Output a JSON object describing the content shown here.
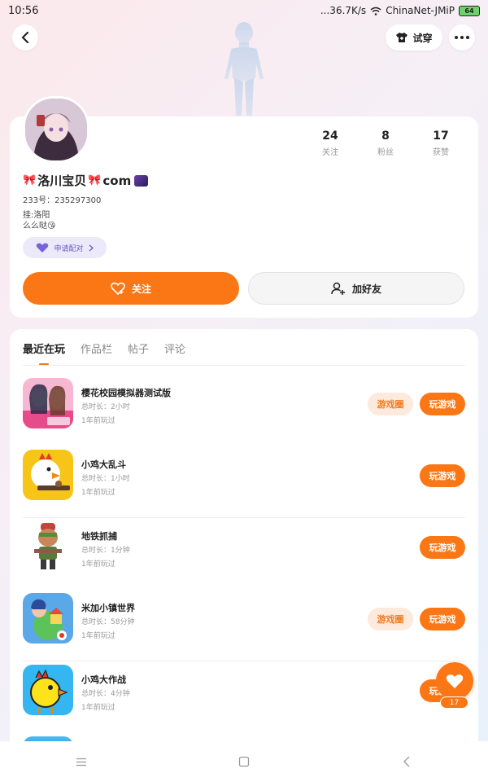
{
  "status_bar": {
    "time": "10:56",
    "network_speed": "...36.7K/s",
    "wifi_name": "ChinaNet-JMiP",
    "battery": "64"
  },
  "top_bar": {
    "try_on_label": "试穿"
  },
  "profile": {
    "stats": [
      {
        "value": "24",
        "label": "关注"
      },
      {
        "value": "8",
        "label": "粉丝"
      },
      {
        "value": "17",
        "label": "获赞"
      }
    ],
    "username_prefix": "🎀",
    "username_main": "洛川宝贝",
    "username_mid": "🎀",
    "username_tail": "com",
    "uid": "233号：235297300",
    "bio_line1": "挂:洛阳",
    "bio_line2": "么么哒😘",
    "pair_label": "申请配对",
    "follow_label": "关注",
    "add_friend_label": "加好友"
  },
  "tabs": [
    {
      "label": "最近在玩",
      "active": true
    },
    {
      "label": "作品栏",
      "active": false
    },
    {
      "label": "帖子",
      "active": false
    },
    {
      "label": "评论",
      "active": false
    }
  ],
  "games": [
    {
      "name": "樱花校园模拟器测试版",
      "duration": "总时长：2小时",
      "last_played": "1年前玩过",
      "has_circle": true,
      "circle_label": "游戏圈",
      "play_label": "玩游戏"
    },
    {
      "name": "小鸡大乱斗",
      "duration": "总时长：1小时",
      "last_played": "1年前玩过",
      "has_circle": false,
      "play_label": "玩游戏"
    },
    {
      "name": "地铁抓捕",
      "duration": "总时长：1分钟",
      "last_played": "1年前玩过",
      "has_circle": false,
      "play_label": "玩游戏"
    },
    {
      "name": "米加小镇世界",
      "duration": "总时长：58分钟",
      "last_played": "1年前玩过",
      "has_circle": true,
      "circle_label": "游戏圈",
      "play_label": "玩游戏"
    },
    {
      "name": "小鸡大作战",
      "duration": "总时长：4分钟",
      "last_played": "1年前玩过",
      "has_circle": false,
      "play_label": "玩游戏"
    }
  ],
  "like_button": {
    "count": "17"
  },
  "colors": {
    "accent": "#fb7614",
    "accent_light": "#fdeadc",
    "pair_bg": "#ece9fb"
  }
}
